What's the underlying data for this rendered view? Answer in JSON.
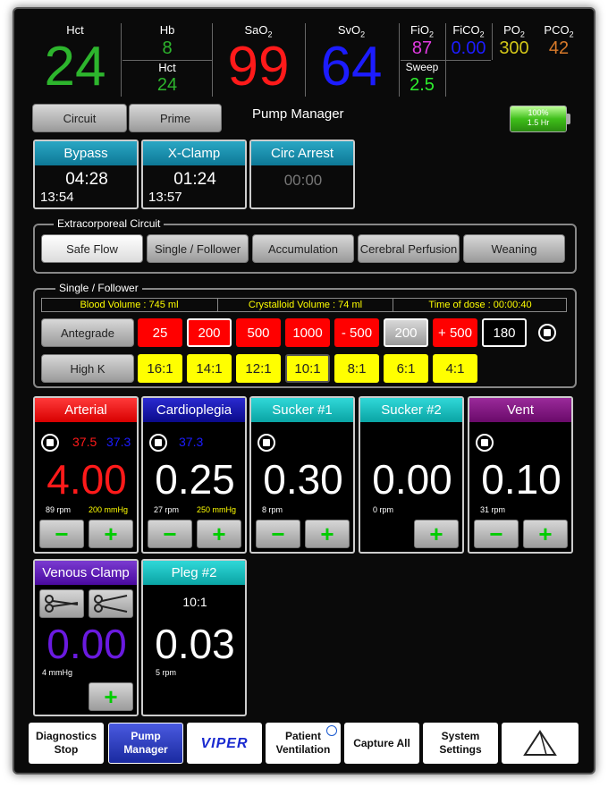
{
  "vitals": {
    "hct_label": "Hct",
    "hct_value": "24",
    "hb_label": "Hb",
    "hb_value": "8",
    "hct2_label": "Hct",
    "hct2_value": "24",
    "sao2_label": "SaO",
    "sao2_sub": "2",
    "sao2_value": "99",
    "svo2_label": "SvO",
    "svo2_sub": "2",
    "svo2_value": "64",
    "fio2_label": "FiO",
    "fio2_sub": "2",
    "fio2_value": "87",
    "fico2_label": "FiCO",
    "fico2_sub": "2",
    "fico2_value": "0.00",
    "po2_label": "PO",
    "po2_sub": "2",
    "po2_value": "300",
    "pco2_label": "PCO",
    "pco2_sub": "2",
    "pco2_value": "42",
    "sweep_label": "Sweep",
    "sweep_value": "2.5"
  },
  "toolbar": {
    "circuit": "Circuit",
    "prime": "Prime",
    "title": "Pump Manager"
  },
  "battery": {
    "percent": "100%",
    "time": "1.5 Hr",
    "level": 1.0
  },
  "timers": {
    "bypass": {
      "label": "Bypass",
      "elapsed": "04:28",
      "start": "13:54"
    },
    "xclamp": {
      "label": "X-Clamp",
      "elapsed": "01:24",
      "start": "13:57"
    },
    "circ_arrest": {
      "label": "Circ Arrest",
      "elapsed": "00:00"
    }
  },
  "circuit": {
    "title": "Extracorporeal Circuit",
    "modes": [
      "Safe Flow",
      "Single / Follower",
      "Accumulation",
      "Cerebral Perfusion",
      "Weaning"
    ],
    "selected": "Safe Flow"
  },
  "single": {
    "title": "Single / Follower",
    "blood_volume": "Blood Volume : 745 ml",
    "crystalloid_volume": "Crystalloid Volume : 74 ml",
    "time_of_dose": "Time of dose : 00:00:40",
    "antegrade": "Antegrade",
    "highk": "High K",
    "volumes": [
      "25",
      "200",
      "500",
      "1000",
      "- 500",
      "200",
      "+ 500",
      "180"
    ],
    "ratios": [
      "16:1",
      "14:1",
      "12:1",
      "10:1",
      "8:1",
      "6:1",
      "4:1"
    ]
  },
  "pumps": {
    "arterial": {
      "label": "Arterial",
      "p1": "37.5",
      "p2": "37.3",
      "flow": "4.00",
      "rpm": "89 rpm",
      "pressure": "200 mmHg"
    },
    "cardioplegia": {
      "label": "Cardioplegia",
      "p2": "37.3",
      "flow": "0.25",
      "rpm": "27 rpm",
      "pressure": "250 mmHg"
    },
    "sucker1": {
      "label": "Sucker #1",
      "flow": "0.30",
      "rpm": "8 rpm"
    },
    "sucker2": {
      "label": "Sucker #2",
      "flow": "0.00",
      "rpm": "0 rpm"
    },
    "vent": {
      "label": "Vent",
      "flow": "0.10",
      "rpm": "31 rpm"
    },
    "venous": {
      "label": "Venous Clamp",
      "flow": "0.00",
      "pressure": "4 mmHg"
    },
    "pleg2": {
      "label": "Pleg #2",
      "ratio": "10:1",
      "flow": "0.03",
      "rpm": "5 rpm"
    }
  },
  "nav": {
    "diag1": "Diagnostics",
    "diag2": "Stop",
    "pump1": "Pump",
    "pump2": "Manager",
    "viper": "VIPER",
    "pv1": "Patient",
    "pv2": "Ventilation",
    "capture": "Capture All",
    "sys1": "System",
    "sys2": "Settings"
  },
  "colors": {
    "green": "#2db52d",
    "red": "#ff1a1a",
    "blue": "#1c1cff",
    "teal": "#0d8fae",
    "navy": "#10109a",
    "purple": "#7a157a",
    "violet": "#5a1aa0"
  }
}
